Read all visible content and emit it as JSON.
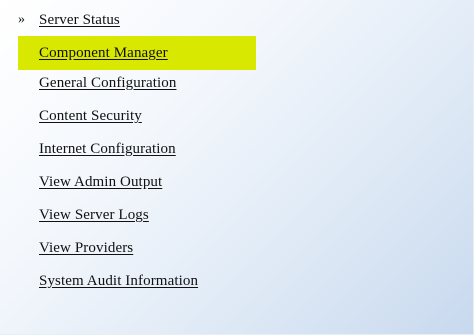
{
  "nav": {
    "marker": "»",
    "items": [
      {
        "label": "Server Status"
      },
      {
        "label": "Component Manager",
        "highlighted": true
      },
      {
        "label": "General Configuration"
      },
      {
        "label": "Content Security"
      },
      {
        "label": "Internet Configuration"
      },
      {
        "label": "View Admin Output"
      },
      {
        "label": "View Server Logs"
      },
      {
        "label": "View Providers"
      },
      {
        "label": "System Audit Information"
      }
    ]
  },
  "colors": {
    "highlight": "#d8e800",
    "panel_background": "#dde8f5",
    "link_text": "#111111"
  }
}
